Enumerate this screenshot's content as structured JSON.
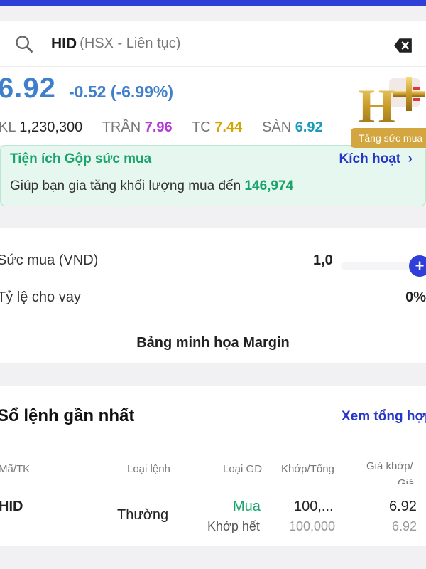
{
  "search": {
    "symbol": "HID",
    "exchange_info": "(HSX - Liên tục)"
  },
  "quote": {
    "price": "6.92",
    "change": "-0.52 (-6.99%)",
    "kl_label": "KL",
    "kl_value": "1,230,300",
    "tran_label": "TRẦN",
    "tran_value": "7.96",
    "tc_label": "TC",
    "tc_value": "7.44",
    "san_label": "SÀN",
    "san_value": "6.92"
  },
  "promo": {
    "title": "Tiện ích Gộp sức mua",
    "action": "Kích hoạt",
    "desc": "Giúp bạn gia tăng khối lượng mua đến",
    "amount": "146,974",
    "badge_letter": "H",
    "badge_label": "Tăng sức mua"
  },
  "account": {
    "buying_power_label": "Sức mua (VND)",
    "buying_power_value": "1,0",
    "loan_ratio_label": "Tỷ lệ cho vay",
    "loan_ratio_value": "0%",
    "margin_button": "Bảng minh họa Margin"
  },
  "orders": {
    "title": "Sổ lệnh gần nhất",
    "see_all": "Xem tổng hợp",
    "columns": [
      "Mã/TK",
      "Loại lệnh",
      "Loại GD",
      "Khớp/Tổng",
      "Giá khớp/",
      "Giá"
    ],
    "row": {
      "symbol": "HID",
      "order_type": "Thường",
      "side": "Mua",
      "status": "Khớp hết",
      "matched": "100,...",
      "total": "100,000",
      "match_price": "6.92",
      "price": "6.92"
    }
  },
  "colors": {
    "accent_blue": "#2f3fd8",
    "price_blue": "#3f7fcc",
    "green": "#1aa36b",
    "purple": "#b33bd6",
    "gold": "#d3a500"
  }
}
